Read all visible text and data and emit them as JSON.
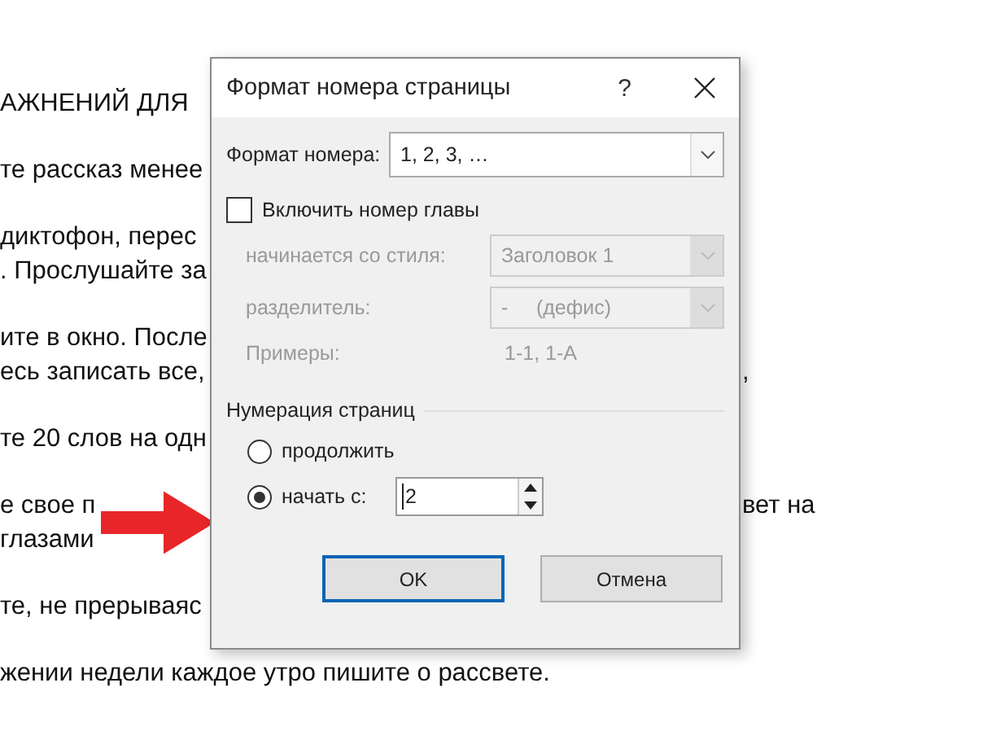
{
  "document": {
    "lines": [
      {
        "left": "АЖНЕНИЙ ДЛЯ"
      },
      {
        "left": "те рассказ менее"
      },
      {
        "left": "диктофон, перес"
      },
      {
        "left": ". Прослушайте за"
      },
      {
        "left": "ите в окно. После"
      },
      {
        "left": "есь записать все,",
        "right": ","
      },
      {
        "left": "те 20 слов на одн"
      },
      {
        "left": "е свое п",
        "right": "вет на"
      },
      {
        "left": "глазами"
      },
      {
        "left": "те, не прерываяс"
      }
    ],
    "last_line": "жении недели каждое утро пишите о рассвете."
  },
  "dialog": {
    "title": "Формат номера страницы",
    "help": "?",
    "number_format": {
      "label": "Формат номера:",
      "value": "1, 2, 3, …",
      "disabled": false
    },
    "include_chapter": {
      "label": "Включить номер главы",
      "checked": false
    },
    "chapter_rows": [
      {
        "kind": "select",
        "label": "начинается со стиля:",
        "value": "Заголовок 1",
        "disabled": true
      },
      {
        "kind": "select",
        "label": "разделитель:",
        "value": "-     (дефис)",
        "disabled": true
      },
      {
        "kind": "text",
        "label": "Примеры:",
        "value": "1-1, 1-А",
        "disabled": true
      }
    ],
    "numbering": {
      "title": "Нумерация страниц",
      "options": [
        {
          "label": "продолжить",
          "selected": false
        },
        {
          "label": "начать с:",
          "selected": true
        }
      ],
      "start_value": "2"
    },
    "buttons": [
      {
        "label": "OK",
        "default": true
      },
      {
        "label": "Отмена",
        "default": false
      }
    ]
  }
}
